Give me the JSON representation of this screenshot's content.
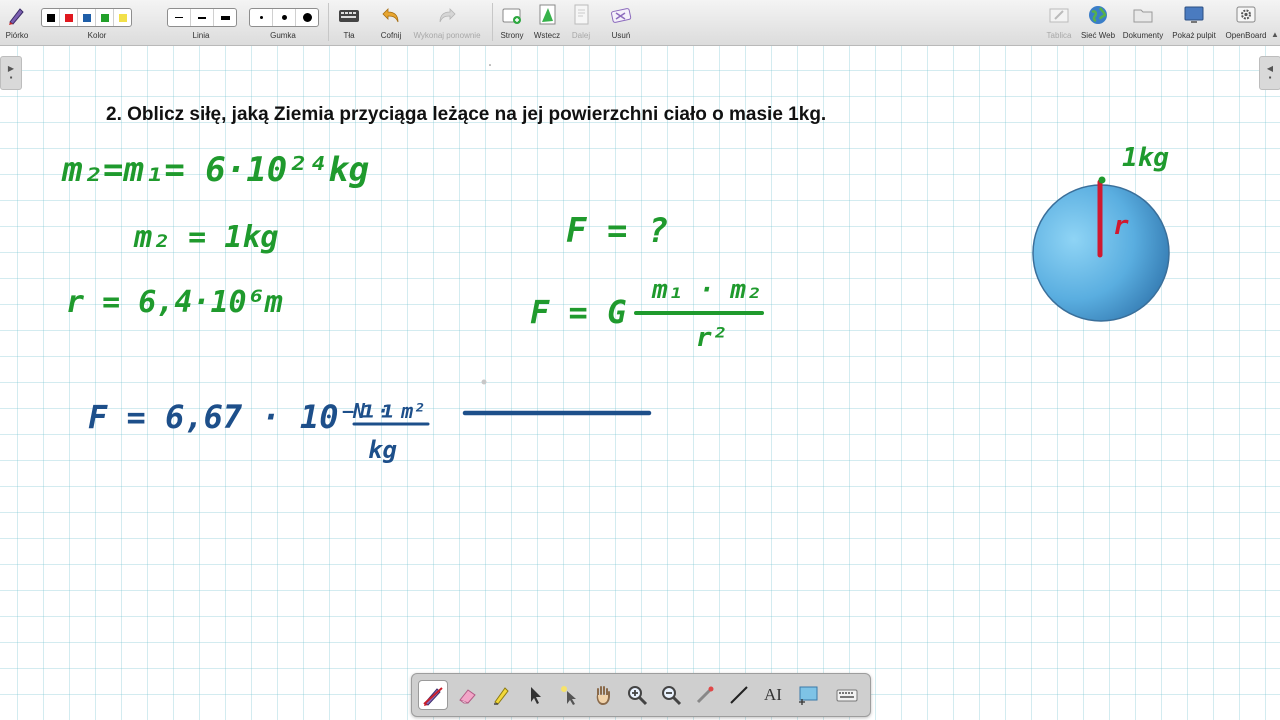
{
  "toolbar": {
    "pen": "Piórko",
    "color": "Kolor",
    "line": "Linia",
    "eraser": "Gumka",
    "backgrounds": "Tła",
    "undo": "Cofnij",
    "redo": "Wykonaj ponownie",
    "pages": "Strony",
    "back": "Wstecz",
    "next": "Dalej",
    "delete": "Usuń",
    "board": "Tablica",
    "web": "Sieć Web",
    "documents": "Dokumenty",
    "show_desktop": "Pokaż pulpit",
    "openboard": "OpenBoard",
    "colors": [
      "#000000",
      "#e0181f",
      "#1f5ea8",
      "#22a02a",
      "#f2e04a"
    ]
  },
  "task": "2. Oblicz siłę, jaką Ziemia przyciąga leżące na jej powierzchni ciało o masie 1kg.",
  "handwriting": {
    "m2_line": "m₂=m₁= 6·10²⁴kg",
    "m2_1kg": "m₂ = 1kg",
    "r_line": "r = 6,4·10⁶m",
    "F_unknown": "F = ?",
    "F_formula_lhs": "F = G",
    "F_formula_num": "m₁ · m₂",
    "F_formula_den": "r²",
    "G_value": "F = 6,67 · 10⁻¹¹",
    "G_unit_num": "N · m²",
    "G_unit_den": "kg",
    "planet_mass": "1kg",
    "planet_radius": "r"
  },
  "ink_colors": {
    "green": "#1f9a2d",
    "blue": "#1d4f8a",
    "red": "#d0192f"
  },
  "stylus_tools": [
    "pen-icon",
    "eraser-icon",
    "marker-icon",
    "pointer-icon",
    "laser-pointer-icon",
    "hand-icon",
    "zoom-in-icon",
    "zoom-out-icon",
    "laser-icon",
    "line-icon",
    "text-icon",
    "capture-icon",
    "keyboard-icon"
  ],
  "stylus_text_tool": "AI"
}
